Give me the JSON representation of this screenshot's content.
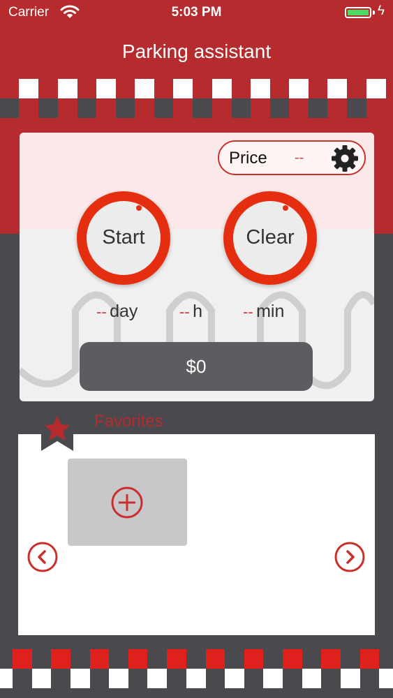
{
  "status_bar": {
    "carrier": "Carrier",
    "time": "5:03 PM"
  },
  "header": {
    "title": "Parking assistant"
  },
  "price": {
    "label": "Price",
    "value": "--"
  },
  "controls": {
    "start_label": "Start",
    "clear_label": "Clear"
  },
  "duration": {
    "day_value": "--",
    "day_unit": "day",
    "hour_value": "--",
    "hour_unit": "h",
    "min_value": "--",
    "min_unit": "min"
  },
  "total": {
    "amount": "$0"
  },
  "favorites": {
    "title": "Favorites"
  },
  "colors": {
    "brand_red": "#b52b2e",
    "dark_gray": "#4a4a4e",
    "knob_red": "#e52d10",
    "battery_green": "#4cd964"
  },
  "icons": [
    "wifi-icon",
    "battery-icon",
    "charging-icon",
    "gear-icon",
    "star-icon",
    "plus-circle-icon",
    "chevron-left-icon",
    "chevron-right-icon"
  ]
}
